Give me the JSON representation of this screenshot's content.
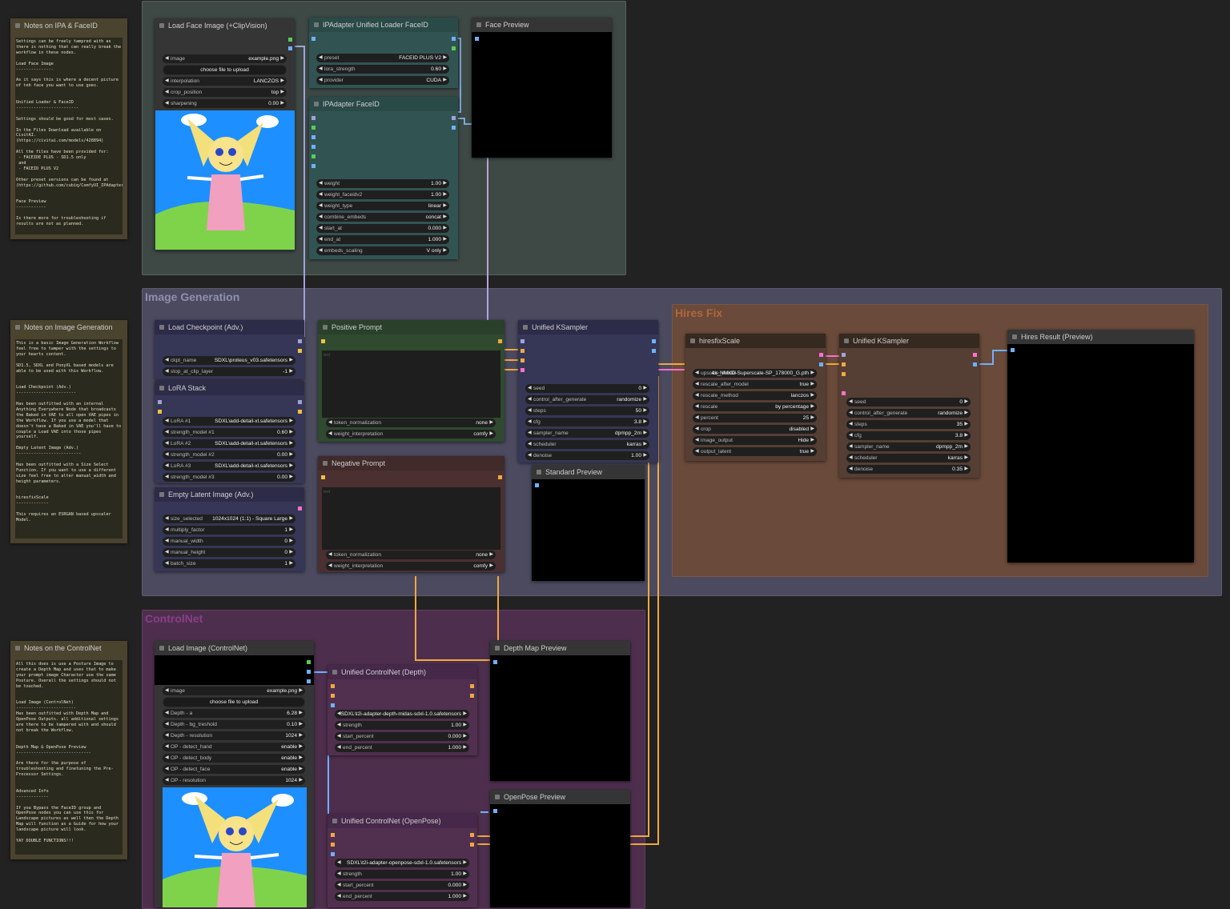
{
  "groups": {
    "faceid": {
      "title": ""
    },
    "image_gen": {
      "title": "Image Generation"
    },
    "hires": {
      "title": "Hires Fix"
    },
    "controlnet": {
      "title": "ControlNet"
    }
  },
  "notes": [
    {
      "title": "Notes on IPA & FaceID",
      "body": "Settings can be freely tampred with as there is nothing that can really break the workflow in these nodes.\n\nLoad Face Image\n---------------\n\nAs it says this is where a decent picture of teh face you want to use goes.\n\n\nUnified Loader & FaceID\n-------------------------\n\nSettings should be good for most cases.\n\nIn the Files Download available on CivitAI.\n(https://civitai.com/models/428894)\n\nAll the files have been provided for:\n - FACEIDE PLUS - SD1.5 only\n and\n - FACEID PLUS V2\n\nOther preset versions can be found at\n(https://github.com/cubiq/ComfyUI_IPAdapter_plus)\n\n\nFace Preview\n------------\n\nIs there more for troubleshooting if results are not as planned."
    },
    {
      "title": "Notes on Image Generation",
      "body": "This is a basic Image Generation Workflow feel free to tamper with the settings to your hearts content.\n\nSD1.5, SDXL and PonyXL based models are able to be used with this Workflow.\n\n\nLoad Checkpoint (Adv.)\n------------------------\n\nHas been outfitted with an internal Anything Everywhere Node that broadcasts the Baked in VAE to all open VAE pipes in the Workflow. If you use a model that doesn't have a Baked in VAE you'll have to couple a Load VAE into those pipes yourself.\n\nEmpty Latent Image (Adv.)\n--------------------------\n\nHas been outfitted with a Size Select Function. If you want to use a different size feel free to alter manual_width and height parameters.\n\n\nhiresfixScale\n-------------\n\nThis requires an ESRGAN based upscaler Model."
    },
    {
      "title": "Notes on the ControlNet",
      "body": "All this does is use a Posture Image to create a Depth Map and uses that to make your prompt image Character use the same Posture. Overall the settings should not be touched.\n\n\nLoad Image (ControlNet)\n------------------------\nHas been outfitted with Depth Map and OpenPose Outputs. all additional settings are there to be tampered with and should not break the Workflow.\n\n\nDepth Map & OpenPose Preview\n------------------------------\n\nAre there for the purpose of troubleshooting and finetuning the Pre-Processor Settings.\n\n\nAdvanced Info\n-------------\n\nIf you Bypass the FaceID group and OpenPose nodes you can use this for Landscape pictures as well then the Depth Map will function as a Guide for how your landscape picture will look.\n\nYAY DOUBLE FUNCTIONS!!!"
    }
  ],
  "load_face": {
    "title": "Load Face Image (+ClipVision)",
    "upload": "choose file to upload",
    "widgets": [
      {
        "label": "image",
        "value": "example.png"
      },
      {
        "label": "interpolation",
        "value": "LANCZOS"
      },
      {
        "label": "crop_position",
        "value": "top"
      },
      {
        "label": "sharpening",
        "value": "0.00"
      }
    ]
  },
  "ipa_loader": {
    "title": "IPAdapter Unified Loader FaceID",
    "widgets": [
      {
        "label": "preset",
        "value": "FACEID PLUS V2"
      },
      {
        "label": "lora_strength",
        "value": "0.60"
      },
      {
        "label": "provider",
        "value": "CUDA"
      }
    ]
  },
  "ipa_faceid": {
    "title": "IPAdapter FaceID",
    "widgets": [
      {
        "label": "weight",
        "value": "1.00"
      },
      {
        "label": "weight_faceidv2",
        "value": "1.00"
      },
      {
        "label": "weight_type",
        "value": "linear"
      },
      {
        "label": "combine_embeds",
        "value": "concat"
      },
      {
        "label": "start_at",
        "value": "0.000"
      },
      {
        "label": "end_at",
        "value": "1.000"
      },
      {
        "label": "embeds_scaling",
        "value": "V only"
      }
    ]
  },
  "face_preview": {
    "title": "Face Preview"
  },
  "checkpoint": {
    "title": "Load Checkpoint (Adv.)",
    "widgets": [
      {
        "label": "ckpt_name",
        "value": "SDXL\\proteus_v03.safetensors"
      },
      {
        "label": "stop_at_clip_layer",
        "value": "-1"
      }
    ]
  },
  "lora_stack": {
    "title": "LoRA Stack",
    "widgets": [
      {
        "label": "LoRA #1",
        "value": "SDXL\\add-detail-xl.safetensors"
      },
      {
        "label": "strength_model #1",
        "value": "0.60"
      },
      {
        "label": "LoRA #2",
        "value": "SDXL\\add-detail-xl.safetensors"
      },
      {
        "label": "strength_model #2",
        "value": "0.00"
      },
      {
        "label": "LoRA #3",
        "value": "SDXL\\add-detail-xl.safetensors"
      },
      {
        "label": "strength_model #3",
        "value": "0.00"
      }
    ]
  },
  "empty_latent": {
    "title": "Empty Latent Image (Adv.)",
    "widgets": [
      {
        "label": "size_selected",
        "value": "1024x1024 (1:1) - Square Large"
      },
      {
        "label": "multiply_factor",
        "value": "1"
      },
      {
        "label": "manual_width",
        "value": "0"
      },
      {
        "label": "manual_height",
        "value": "0"
      },
      {
        "label": "batch_size",
        "value": "1"
      }
    ]
  },
  "pos_prompt": {
    "title": "Positive Prompt",
    "text_placeholder": "text",
    "widgets": [
      {
        "label": "token_normalization",
        "value": "none"
      },
      {
        "label": "weight_interpretation",
        "value": "comfy"
      }
    ]
  },
  "neg_prompt": {
    "title": "Negative Prompt",
    "text_placeholder": "text",
    "widgets": [
      {
        "label": "token_normalization",
        "value": "none"
      },
      {
        "label": "weight_interpretation",
        "value": "comfy"
      }
    ]
  },
  "ksampler": {
    "title": "Unified KSampler",
    "widgets": [
      {
        "label": "seed",
        "value": "0"
      },
      {
        "label": "control_after_generate",
        "value": "randomize"
      },
      {
        "label": "steps",
        "value": "50"
      },
      {
        "label": "cfg",
        "value": "3.8"
      },
      {
        "label": "sampler_name",
        "value": "dpmpp_2m"
      },
      {
        "label": "scheduler",
        "value": "karras"
      },
      {
        "label": "denoise",
        "value": "1.00"
      }
    ]
  },
  "std_preview": {
    "title": "Standard Preview"
  },
  "hiresfix": {
    "title": "hiresfixScale",
    "widgets": [
      {
        "label": "upscale_model",
        "value": "4x_NMKD-Superscale-SP_178000_G.pth"
      },
      {
        "label": "rescale_after_model",
        "value": "true"
      },
      {
        "label": "rescale_method",
        "value": "lanczos"
      },
      {
        "label": "rescale",
        "value": "by percentage"
      },
      {
        "label": "percent",
        "value": "25"
      },
      {
        "label": "crop",
        "value": "disabled"
      },
      {
        "label": "image_output",
        "value": "Hide"
      },
      {
        "label": "output_latent",
        "value": "true"
      }
    ]
  },
  "ksampler2": {
    "title": "Unified KSampler",
    "widgets": [
      {
        "label": "seed",
        "value": "0"
      },
      {
        "label": "control_after_generate",
        "value": "randomize"
      },
      {
        "label": "steps",
        "value": "35"
      },
      {
        "label": "cfg",
        "value": "3.8"
      },
      {
        "label": "sampler_name",
        "value": "dpmpp_2m"
      },
      {
        "label": "scheduler",
        "value": "karras"
      },
      {
        "label": "denoise",
        "value": "0.35"
      }
    ]
  },
  "hires_preview": {
    "title": "Hires Result (Preview)"
  },
  "load_cn": {
    "title": "Load Image (ControlNet)",
    "upload": "choose file to upload",
    "widgets": [
      {
        "label": "image",
        "value": "example.png"
      },
      {
        "label": "Depth - a",
        "value": "6.28"
      },
      {
        "label": "Depth - bg_treshold",
        "value": "0.10"
      },
      {
        "label": "Depth - resolution",
        "value": "1024"
      },
      {
        "label": "OP - detect_hand",
        "value": "enable"
      },
      {
        "label": "OP - detect_body",
        "value": "enable"
      },
      {
        "label": "OP - detect_face",
        "value": "enable"
      },
      {
        "label": "OP - resolution",
        "value": "1024"
      }
    ]
  },
  "cn_depth": {
    "title": "Unified ControlNet (Depth)",
    "widgets": [
      {
        "label": "",
        "value": "SDXL\\t2i-adapter-depth-midas-sdxl-1.0.safetensors"
      },
      {
        "label": "strength",
        "value": "1.00"
      },
      {
        "label": "start_percent",
        "value": "0.000"
      },
      {
        "label": "end_percent",
        "value": "1.000"
      }
    ]
  },
  "cn_openpose": {
    "title": "Unified ControlNet (OpenPose)",
    "widgets": [
      {
        "label": "",
        "value": "SDXL\\t2i-adapter-openpose-sdxl-1.0.safetensors"
      },
      {
        "label": "strength",
        "value": "1.00"
      },
      {
        "label": "start_percent",
        "value": "0.000"
      },
      {
        "label": "end_percent",
        "value": "1.000"
      }
    ]
  },
  "depth_preview": {
    "title": "Depth Map Preview"
  },
  "openpose_preview": {
    "title": "OpenPose Preview"
  }
}
